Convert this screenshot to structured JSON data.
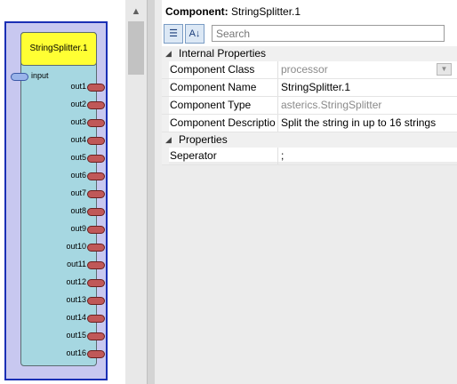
{
  "component_panel": {
    "component_name": "StringSplitter.1",
    "input_port": "input",
    "output_ports": [
      "out1",
      "out2",
      "out3",
      "out4",
      "out5",
      "out6",
      "out7",
      "out8",
      "out9",
      "out10",
      "out11",
      "out12",
      "out13",
      "out14",
      "out15",
      "out16"
    ]
  },
  "properties_panel": {
    "header_label": "Component:",
    "header_value": "StringSplitter.1",
    "search_placeholder": "Search",
    "categorized_icon": "categorized-view-icon",
    "alphabetical_icon": "alphabetical-sort-icon",
    "sections": [
      {
        "title": "Internal Properties",
        "rows": [
          {
            "name": "Component Class",
            "value": "processor"
          },
          {
            "name": "Component Name",
            "value": "StringSplitter.1"
          },
          {
            "name": "Component Type",
            "value": "asterics.StringSplitter"
          },
          {
            "name": "Component Descriptio",
            "value": "Split the string in up to 16 strings"
          }
        ]
      },
      {
        "title": "Properties",
        "rows": [
          {
            "name": "Seperator",
            "value": ";"
          }
        ]
      }
    ]
  }
}
